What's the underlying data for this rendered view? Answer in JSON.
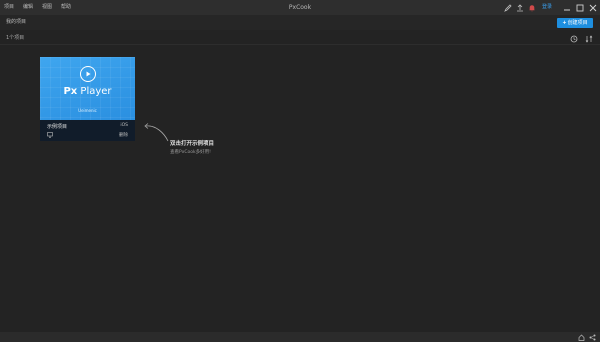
{
  "window": {
    "title": "PxCook",
    "menu": [
      "项目",
      "编辑",
      "视图",
      "帮助"
    ],
    "login_label": "登录",
    "icons": [
      "pen-icon",
      "upload-icon",
      "bell-icon"
    ]
  },
  "toolbar": {
    "section_title": "我的项目",
    "new_project_label": "创建项目"
  },
  "subbar": {
    "project_count": "1个项目",
    "icons": [
      "clock-icon",
      "sort-icon"
    ]
  },
  "project_card": {
    "thumbnail_logo_prefix": "Px",
    "thumbnail_logo_rest": " Player",
    "thumbnail_caption": "Ueimenic",
    "name": "示例项目",
    "platform": "iOS",
    "delete_label": "删除"
  },
  "hint": {
    "title": "双击打开示例项目",
    "subtitle": "查看PxCook多好用!"
  },
  "colors": {
    "accent": "#1e8fe0",
    "background": "#232323",
    "titlebar": "#2e2e2e",
    "card_thumb": "#3fa6ef"
  }
}
